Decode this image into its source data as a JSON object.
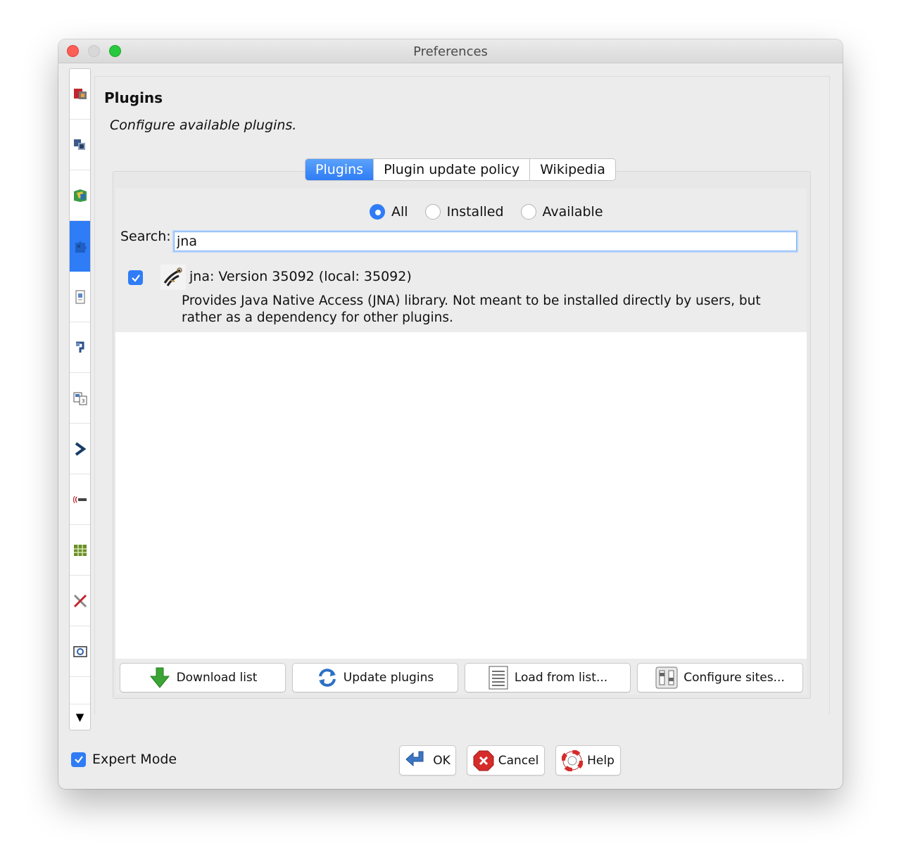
{
  "window": {
    "title": "Preferences"
  },
  "sidebar": {
    "items": [
      {
        "icon": "display-settings-icon"
      },
      {
        "icon": "layers-icon"
      },
      {
        "icon": "map-projection-icon"
      },
      {
        "icon": "plugins-icon",
        "active": true
      },
      {
        "icon": "presets-icon"
      },
      {
        "icon": "shortcuts-icon"
      },
      {
        "icon": "validator-icon"
      },
      {
        "icon": "remote-control-icon"
      },
      {
        "icon": "audio-icon"
      },
      {
        "icon": "imagery-icon"
      },
      {
        "icon": "advanced-tools-icon"
      },
      {
        "icon": "connection-icon"
      }
    ],
    "more_glyph": "▼"
  },
  "page": {
    "title": "Plugins",
    "subtitle": "Configure available plugins."
  },
  "tabs": [
    {
      "label": "Plugins",
      "selected": true
    },
    {
      "label": "Plugin update policy",
      "selected": false
    },
    {
      "label": "Wikipedia",
      "selected": false
    }
  ],
  "filter": {
    "options": [
      {
        "label": "All",
        "checked": true
      },
      {
        "label": "Installed",
        "checked": false
      },
      {
        "label": "Available",
        "checked": false
      }
    ]
  },
  "search": {
    "label": "Search:",
    "value": "jna"
  },
  "plugins": [
    {
      "checked": true,
      "name": "jna: Version 35092 (local: 35092)",
      "description": "Provides Java Native Access (JNA) library. Not meant to be installed directly by users, but rather as a dependency for other plugins."
    }
  ],
  "actions": {
    "download_list": "Download list",
    "update_plugins": "Update plugins",
    "load_from_list": "Load from list...",
    "configure_sites": "Configure sites..."
  },
  "footer": {
    "expert_mode_label": "Expert Mode",
    "expert_mode_checked": true,
    "ok": "OK",
    "cancel": "Cancel",
    "help": "Help"
  },
  "colors": {
    "accent": "#2f7cf6",
    "window_bg": "#ececec"
  }
}
